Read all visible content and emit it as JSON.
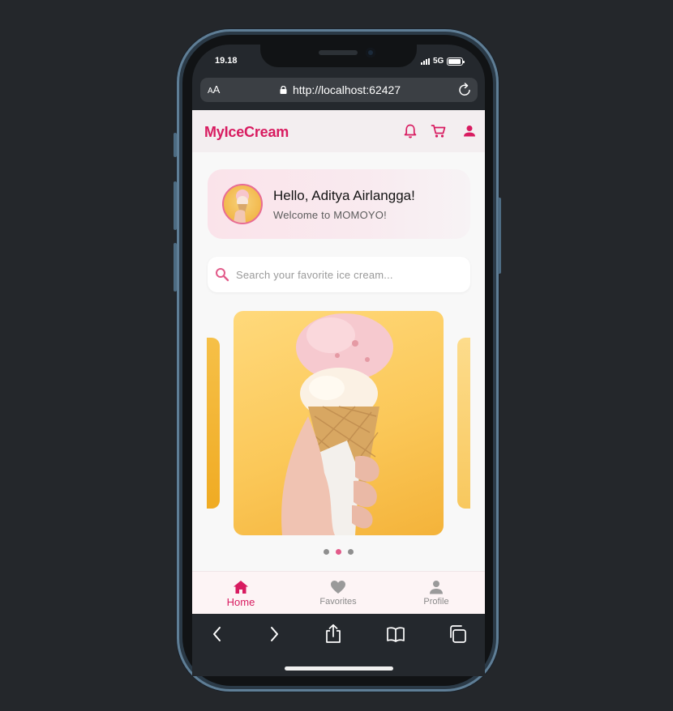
{
  "status_bar": {
    "time": "19.18",
    "network": "5G",
    "battery_level": 0.9
  },
  "browser": {
    "text_size_label_small": "A",
    "text_size_label_large": "A",
    "url": "http://localhost:62427",
    "icons": {
      "lock": "lock-icon",
      "reload": "reload-icon",
      "back": "chevron-left-icon",
      "forward": "chevron-right-icon",
      "share": "share-icon",
      "bookmarks": "book-icon",
      "tabs": "tabs-icon"
    }
  },
  "app": {
    "title": "MyIceCream",
    "brand_color": "#d81b60",
    "header_icons": [
      "bell-icon",
      "cart-icon",
      "person-icon"
    ],
    "greeting": {
      "title": "Hello, Aditya Airlangga!",
      "subtitle": "Welcome to MOMOYO!"
    },
    "search": {
      "placeholder": "Search your favorite ice cream...",
      "value": ""
    },
    "carousel": {
      "slide_count": 3,
      "active_index": 1
    },
    "bottom_nav": {
      "items": [
        {
          "label": "Home",
          "icon": "home-icon",
          "active": true
        },
        {
          "label": "Favorites",
          "icon": "heart-icon",
          "active": false
        },
        {
          "label": "Profile",
          "icon": "person-icon",
          "active": false
        }
      ]
    }
  }
}
